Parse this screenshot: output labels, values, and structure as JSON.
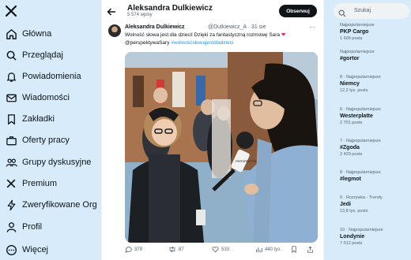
{
  "nav": {
    "items": [
      {
        "label": "Główna",
        "icon": "home-icon"
      },
      {
        "label": "Przeglądaj",
        "icon": "search-icon"
      },
      {
        "label": "Powiadomienia",
        "icon": "bell-icon"
      },
      {
        "label": "Wiadomości",
        "icon": "mail-icon"
      },
      {
        "label": "Zakładki",
        "icon": "bookmark-icon"
      },
      {
        "label": "Oferty pracy",
        "icon": "briefcase-icon"
      },
      {
        "label": "Grupy dyskusyjne",
        "icon": "people-icon"
      },
      {
        "label": "Premium",
        "icon": "x-logo-icon"
      },
      {
        "label": "Zweryfikowane Org",
        "icon": "lightning-icon"
      },
      {
        "label": "Profil",
        "icon": "person-icon"
      },
      {
        "label": "Więcej",
        "icon": "more-circle-icon"
      }
    ]
  },
  "header": {
    "name": "Aleksandra Dulkiewicz",
    "posts": "5 574 wpisy",
    "follow": "Obserwuj"
  },
  "tweet": {
    "author": "Aleksandra Dulkiewicz",
    "handle": "@Dutkiewicz_A · 31 sie",
    "text_part1": "Wolność słowa jest dla dzieci! Dzięki za fantastyczną rozmowę Sara ",
    "heart": "❤",
    "mention": "@perspektywaSary",
    "hashtag": "#wolnośćsłowajestdladzieci",
    "mic_logo": "PERSPEKTYWA SARY"
  },
  "actions": {
    "replies": "379",
    "reposts": "87",
    "likes": "533",
    "views": "440 tys."
  },
  "search": {
    "placeholder": "Szukaj"
  },
  "trends": [
    {
      "meta": "Najpopularniejsze",
      "name": "PKP Cargo",
      "count": "1 606 posts"
    },
    {
      "meta": "Najpopularniejsze",
      "name": "#gortor",
      "count": ""
    },
    {
      "meta": "8 · Najpopularniejsze",
      "name": "Niemcy",
      "count": "12,2 tys. posts"
    },
    {
      "meta": "6 · Najpopularniejsze",
      "name": "Westerplatte",
      "count": "2 701 posts"
    },
    {
      "meta": "7 · Najpopularniejsze",
      "name": "#Zgoda",
      "count": "2 429 posts"
    },
    {
      "meta": "8 · Najpopularniejsze",
      "name": "#legmot",
      "count": ""
    },
    {
      "meta": "9 · Rozrywka · Trendy",
      "name": "Jedi",
      "count": "13,8 tys. posts"
    },
    {
      "meta": "10 · Najpopularniejsze",
      "name": "Londynie",
      "count": "7 012 posts"
    }
  ],
  "colors": {
    "accent": "#1d9bf0",
    "background": "#d7ebfa",
    "heart": "#e0245e"
  }
}
